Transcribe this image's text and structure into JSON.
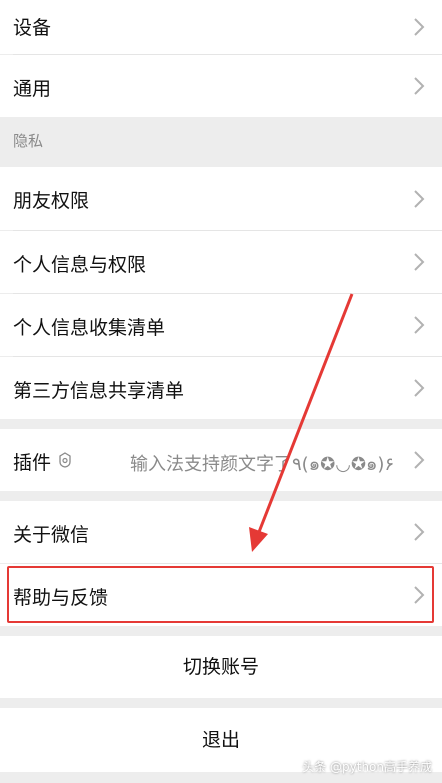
{
  "rows": {
    "device": "设备",
    "general": "通用",
    "privacy_header": "隐私",
    "friend_permissions": "朋友权限",
    "personal_info_permissions": "个人信息与权限",
    "personal_info_collection": "个人信息收集清单",
    "third_party_sharing": "第三方信息共享清单",
    "plugins": "插件",
    "plugins_note": "输入法支持颜文字了٩(๑✪◡✪๑)۶",
    "about": "关于微信",
    "help_feedback": "帮助与反馈"
  },
  "buttons": {
    "switch_account": "切换账号",
    "logout": "退出"
  },
  "watermark": "头条 @python高手养成",
  "colors": {
    "background": "#ededed",
    "annotation_red": "#e53935",
    "chevron": "#b2b2b2"
  },
  "icons": [
    "chevron-right-icon",
    "plugin-icon",
    "annotation-arrow"
  ]
}
